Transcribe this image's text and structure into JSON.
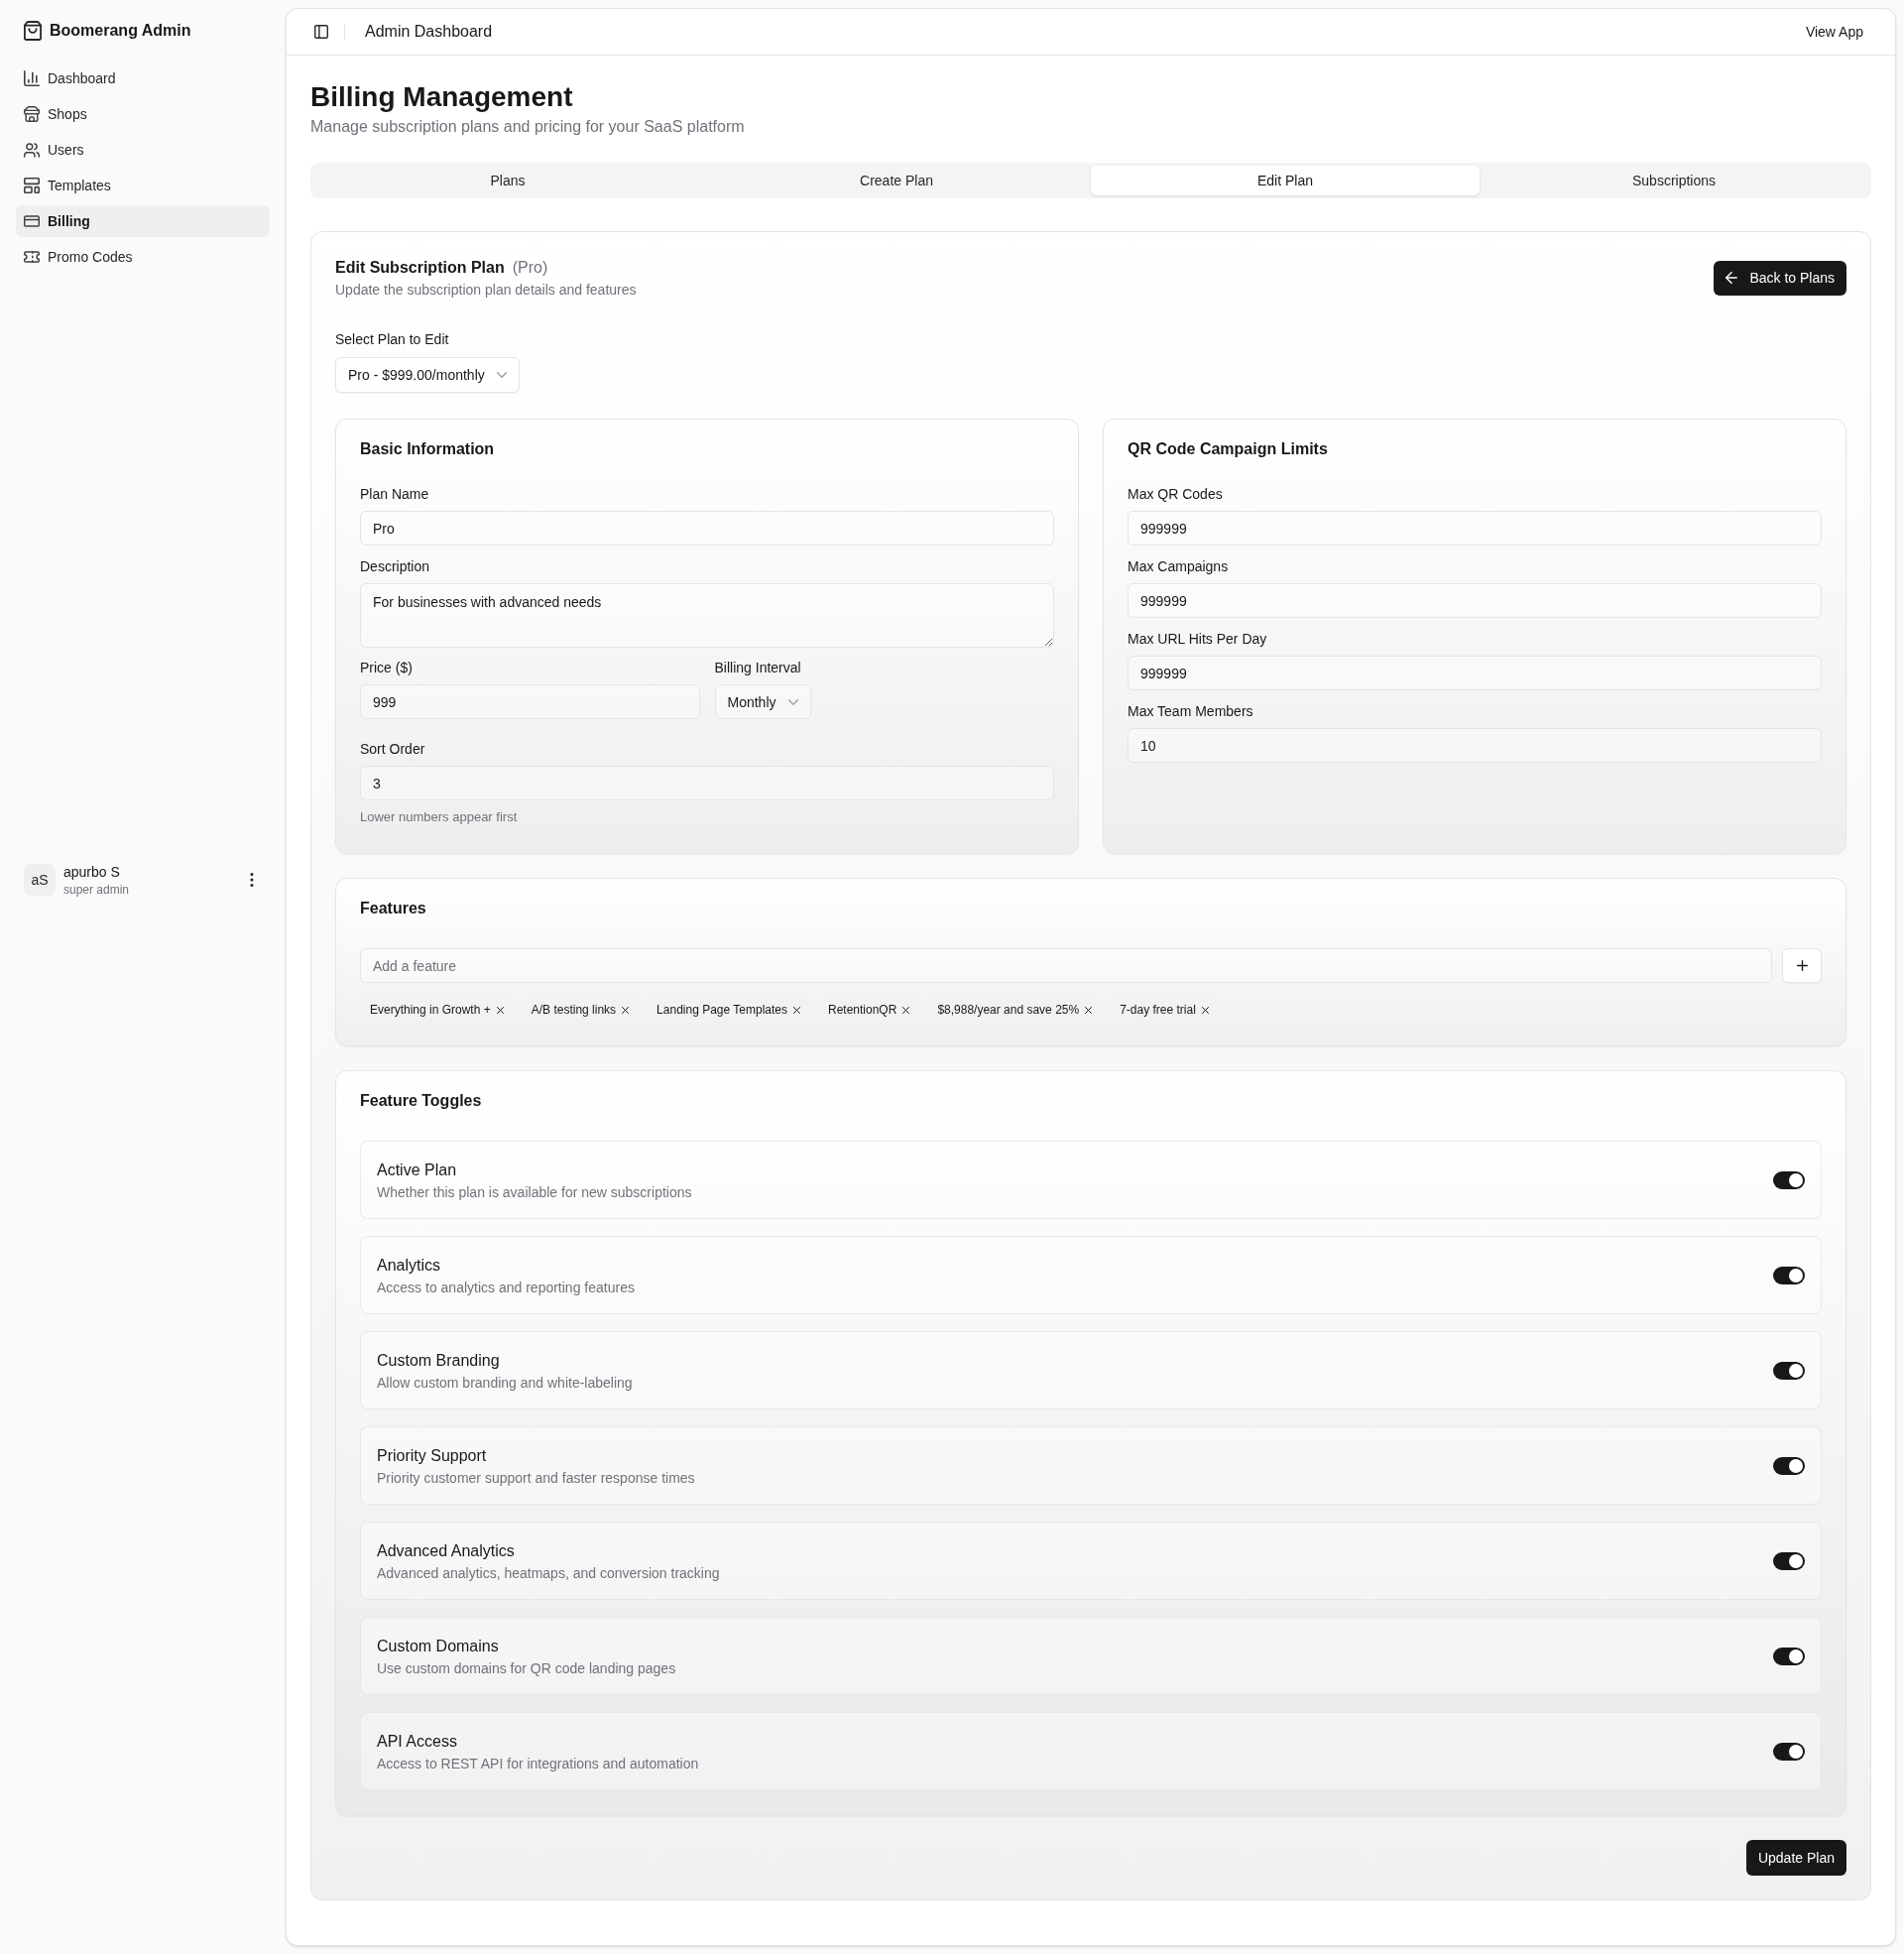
{
  "sidebar": {
    "brand": "Boomerang Admin",
    "items": [
      {
        "label": "Dashboard",
        "selected": false
      },
      {
        "label": "Shops",
        "selected": false
      },
      {
        "label": "Users",
        "selected": false
      },
      {
        "label": "Templates",
        "selected": false
      },
      {
        "label": "Billing",
        "selected": true
      },
      {
        "label": "Promo Codes",
        "selected": false
      }
    ],
    "user": {
      "initials": "aS",
      "name": "apurbo S",
      "role": "super admin"
    }
  },
  "header": {
    "title": "Admin Dashboard",
    "link": "View App"
  },
  "page": {
    "title": "Billing Management",
    "subtitle": "Manage subscription plans and pricing for your SaaS platform"
  },
  "tabs": [
    {
      "label": "Plans",
      "selected": false
    },
    {
      "label": "Create Plan",
      "selected": false
    },
    {
      "label": "Edit Plan",
      "selected": true
    },
    {
      "label": "Subscriptions",
      "selected": false
    }
  ],
  "edit_plan": {
    "title": "Edit Subscription Plan",
    "current_plan": "(Pro)",
    "subtitle": "Update the subscription plan details and features",
    "back_button": "Back to Plans",
    "plan_select": {
      "label": "Select Plan to Edit",
      "value": "Pro - $999.00/monthly"
    }
  },
  "basic_information": {
    "title": "Basic Information",
    "plan_name": {
      "label": "Plan Name",
      "value": "Pro"
    },
    "description": {
      "label": "Description",
      "value": "For businesses with advanced needs"
    },
    "price": {
      "label": "Price ($)",
      "value": "999"
    },
    "billing_interval": {
      "label": "Billing Interval",
      "value": "Monthly"
    },
    "sort_order": {
      "label": "Sort Order",
      "value": "3",
      "hint": "Lower numbers appear first"
    }
  },
  "qr_code_campaign_limits": {
    "title": "QR Code Campaign Limits",
    "fields": [
      {
        "label": "Max QR Codes",
        "value": "999999"
      },
      {
        "label": "Max Campaigns",
        "value": "999999"
      },
      {
        "label": "Max URL Hits Per Day",
        "value": "999999"
      },
      {
        "label": "Max Team Members",
        "value": "10"
      }
    ]
  },
  "features": {
    "title": "Features",
    "placeholder": "Add a feature",
    "tags": [
      "Everything in Growth +",
      "A/B testing links",
      "Landing Page Templates",
      "RetentionQR",
      "$8,988/year and save 25%",
      "7-day free trial"
    ]
  },
  "feature_toggles": {
    "title": "Feature Toggles",
    "items": [
      {
        "title": "Active Plan",
        "description": "Whether this plan is available for new subscriptions",
        "on": true
      },
      {
        "title": "Analytics",
        "description": "Access to analytics and reporting features",
        "on": true
      },
      {
        "title": "Custom Branding",
        "description": "Allow custom branding and white-labeling",
        "on": true
      },
      {
        "title": "Priority Support",
        "description": "Priority customer support and faster response times",
        "on": true
      },
      {
        "title": "Advanced Analytics",
        "description": "Advanced analytics, heatmaps, and conversion tracking",
        "on": true
      },
      {
        "title": "Custom Domains",
        "description": "Use custom domains for QR code landing pages",
        "on": true
      },
      {
        "title": "API Access",
        "description": "Access to REST API for integrations and automation",
        "on": true
      }
    ]
  },
  "update_button": "Update Plan"
}
